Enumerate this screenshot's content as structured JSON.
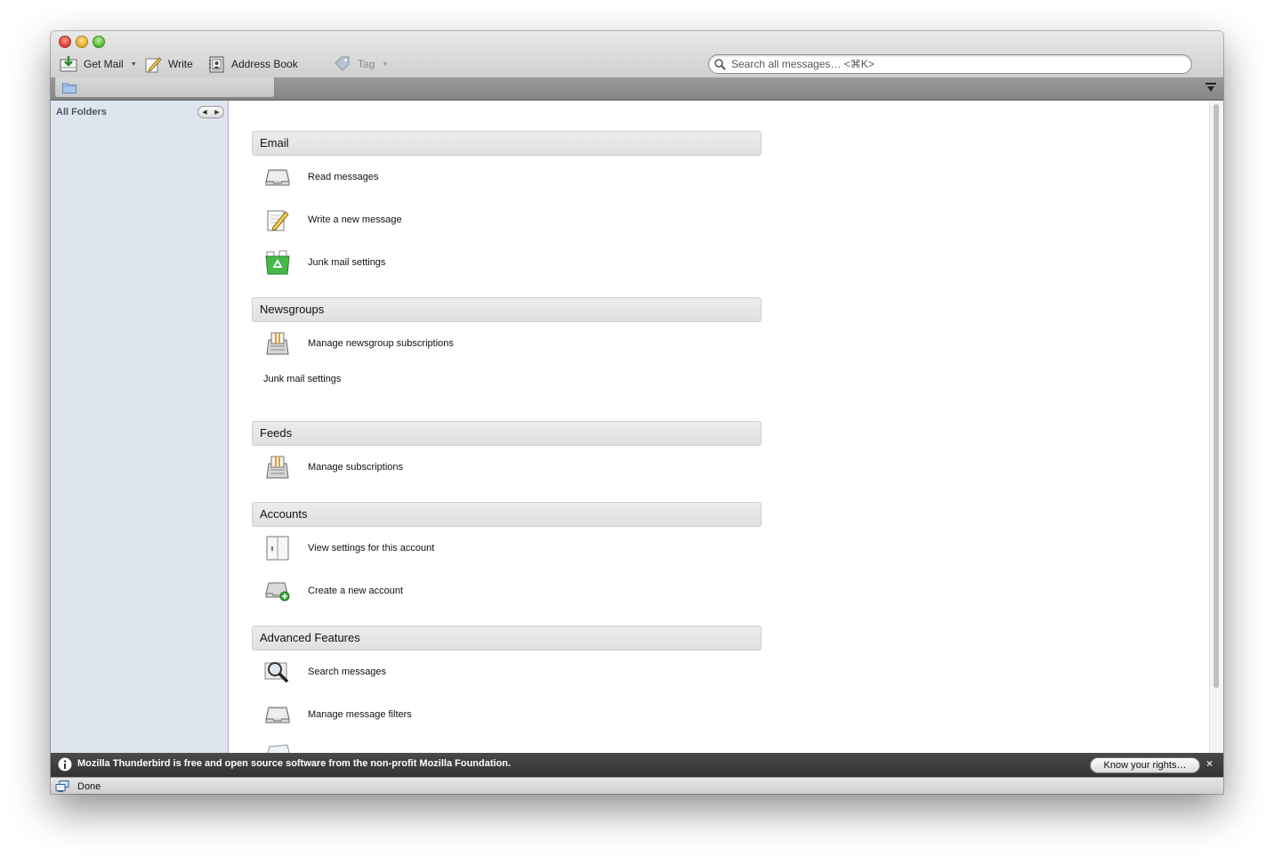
{
  "window": {
    "controls": [
      "close",
      "minimize",
      "zoom"
    ]
  },
  "toolbar": {
    "get_mail_label": "Get Mail",
    "write_label": "Write",
    "address_book_label": "Address Book",
    "tag_label": "Tag",
    "search": {
      "placeholder": "Search all messages… <⌘K>",
      "value": ""
    }
  },
  "tabs": [
    {
      "icon": "folder-icon",
      "label": ""
    }
  ],
  "sidebar": {
    "header": "All Folders"
  },
  "main": {
    "sections": [
      {
        "title": "Email",
        "items": [
          {
            "icon": "inbox-tray-icon",
            "label": "Read messages"
          },
          {
            "icon": "pencil-paper-icon",
            "label": "Write a new message"
          },
          {
            "icon": "recycle-bin-icon",
            "label": "Junk mail settings"
          }
        ]
      },
      {
        "title": "Newsgroups",
        "items": [
          {
            "icon": "newsgroup-binder-icon",
            "label": "Manage newsgroup subscriptions"
          }
        ],
        "plain_items": [
          "Junk mail settings"
        ]
      },
      {
        "title": "Feeds",
        "items": [
          {
            "icon": "newsgroup-binder-icon",
            "label": "Manage subscriptions"
          }
        ]
      },
      {
        "title": "Accounts",
        "items": [
          {
            "icon": "settings-panel-icon",
            "label": "View settings for this account"
          },
          {
            "icon": "add-account-icon",
            "label": "Create a new account"
          }
        ]
      },
      {
        "title": "Advanced Features",
        "items": [
          {
            "icon": "magnifier-icon",
            "label": "Search messages"
          },
          {
            "icon": "filter-tray-icon",
            "label": "Manage message filters"
          }
        ]
      }
    ]
  },
  "notification": {
    "text": "Mozilla Thunderbird is free and open source software from the non-profit Mozilla Foundation.",
    "button_label": "Know your rights…",
    "close_label": "×"
  },
  "status": {
    "text": "Done"
  },
  "colors": {
    "sidebar_bg": "#dfe5ed",
    "section_header_bg": "#e6e6e6",
    "notification_bg": "#3c3c3c"
  }
}
